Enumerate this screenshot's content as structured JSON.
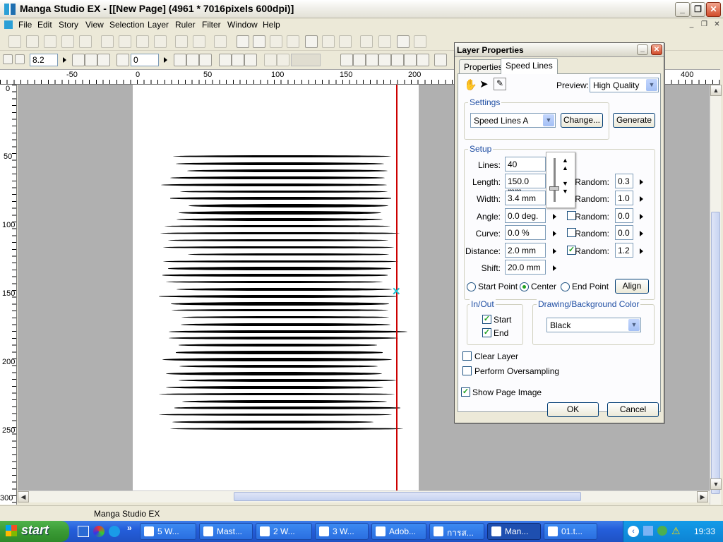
{
  "window": {
    "title": "Manga Studio EX - [[New Page] (4961 * 7016pixels 600dpi)]"
  },
  "menu": [
    "File",
    "Edit",
    "Story",
    "View",
    "Selection",
    "Layer",
    "Ruler",
    "Filter",
    "Window",
    "Help"
  ],
  "toolbar2": {
    "zoom": "8.2",
    "rotation": "0"
  },
  "hruler": [
    "-50",
    "0",
    "50",
    "100",
    "150",
    "200",
    "400"
  ],
  "vruler": [
    "0",
    "50",
    "100",
    "150",
    "200",
    "250",
    "300"
  ],
  "statusbar": {
    "text": "Manga Studio EX"
  },
  "dialog": {
    "title": "Layer Properties",
    "tabs": [
      "Properties",
      "Speed Lines"
    ],
    "preview_label": "Preview:",
    "preview_value": "High Quality",
    "settings_group": "Settings",
    "settings_value": "Speed Lines A",
    "change_button": "Change...",
    "generate_button": "Generate",
    "setup_group": "Setup",
    "fields": [
      {
        "label": "Lines:",
        "value": "40"
      },
      {
        "label": "Length:",
        "value": "150.0 mm"
      },
      {
        "label": "Width:",
        "value": "3.4 mm"
      },
      {
        "label": "Angle:",
        "value": "0.0 deg."
      },
      {
        "label": "Curve:",
        "value": "0.0 %"
      },
      {
        "label": "Distance:",
        "value": "2.0 mm"
      },
      {
        "label": "Shift:",
        "value": "20.0 mm"
      }
    ],
    "random_label": "Random:",
    "randoms": [
      {
        "value": "0.3"
      },
      {
        "value": "1.0"
      },
      {
        "checked": false,
        "value": "0.0"
      },
      {
        "checked": false,
        "value": "0.0"
      },
      {
        "checked": true,
        "value": "1.2"
      }
    ],
    "anchor": {
      "start": "Start Point",
      "center": "Center",
      "end": "End Point",
      "selected": "Center"
    },
    "align_button": "Align",
    "inout_group": "In/Out",
    "inout_start": "Start",
    "inout_end": "End",
    "color_group": "Drawing/Background Color",
    "color_value": "Black",
    "clear_layer": "Clear Layer",
    "oversampling": "Perform Oversampling",
    "show_page_image": "Show Page Image",
    "ok_button": "OK",
    "cancel_button": "Cancel"
  },
  "taskbar": {
    "start": "start",
    "tasks": [
      {
        "label": "5 W...",
        "active": false
      },
      {
        "label": "Mast...",
        "active": false
      },
      {
        "label": "2 W...",
        "active": false
      },
      {
        "label": "3 W...",
        "active": false
      },
      {
        "label": "Adob...",
        "active": false
      },
      {
        "label": "การส...",
        "active": false
      },
      {
        "label": "Man...",
        "active": true
      },
      {
        "label": "01.t...",
        "active": false
      }
    ],
    "clock": "19:33"
  },
  "speed_lines": {
    "count": 40,
    "color": "#000000"
  },
  "colors": {
    "axis_line": "#cc0000",
    "center_marker": "#20c0d0"
  }
}
